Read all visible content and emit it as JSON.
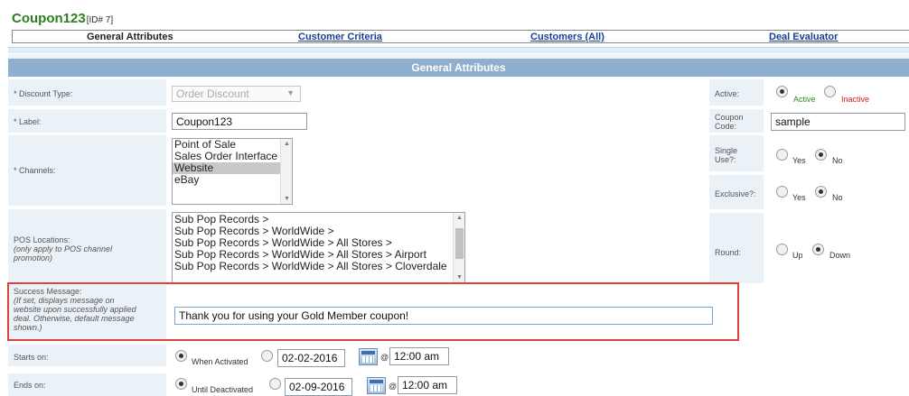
{
  "page": {
    "title": "Coupon123",
    "id_tag": "[ID# 7]"
  },
  "tabs": [
    {
      "label": "General Attributes",
      "active": true
    },
    {
      "label": "Customer Criteria",
      "active": false
    },
    {
      "label": "Customers (All)",
      "active": false
    },
    {
      "label": "Deal Evaluator",
      "active": false
    }
  ],
  "section_header": "General Attributes",
  "discount_type": {
    "label": "* Discount Type:",
    "value": "Order Discount"
  },
  "label_field": {
    "label": "* Label:",
    "value": "Coupon123"
  },
  "channels": {
    "label": "* Channels:",
    "options": [
      "Point of Sale",
      "Sales Order Interface",
      "Website",
      "eBay"
    ],
    "selected": "Website"
  },
  "pos_locations": {
    "label": "POS Locations:",
    "note1": "(only apply to POS channel",
    "note2": "promotion)",
    "options": [
      "Sub Pop Records >",
      "Sub Pop Records > WorldWide >",
      "Sub Pop Records > WorldWide > All Stores >",
      "Sub Pop Records > WorldWide > All Stores > Airport",
      "Sub Pop Records > WorldWide > All Stores > Cloverdale"
    ]
  },
  "success_message": {
    "label": "Success Message:",
    "note_lines": [
      "(If set, displays message on",
      "website upon successfully applied",
      "deal. Otherwise, default message",
      "shown.)"
    ],
    "value": "Thank you for using your Gold Member coupon!"
  },
  "starts_on": {
    "label": "Starts on:",
    "radio_label": "When Activated",
    "date": "02-02-2016",
    "at": "@",
    "time": "12:00 am"
  },
  "ends_on": {
    "label": "Ends on:",
    "radio_label": "Until Deactivated",
    "date": "02-09-2016",
    "at": "@",
    "time": "12:00 am"
  },
  "active": {
    "label": "Active:",
    "on_label": "Active",
    "off_label": "Inactive",
    "selected": "Active"
  },
  "coupon_code": {
    "label1": "Coupon",
    "label2": "Code:",
    "value": "sample"
  },
  "single_use": {
    "label1": "Single",
    "label2": "Use?:",
    "yes": "Yes",
    "no": "No",
    "selected": "No"
  },
  "exclusive": {
    "label": "Exclusive?:",
    "yes": "Yes",
    "no": "No",
    "selected": "No"
  },
  "round": {
    "label": "Round:",
    "up": "Up",
    "down": "Down",
    "selected": "Down"
  },
  "colors": {
    "title_green": "#2e7d1f",
    "header_blue": "#8eafd0",
    "cell_bg": "#eaf1f7",
    "highlight_red": "#e0413f",
    "link_blue": "#1a3f8f"
  }
}
